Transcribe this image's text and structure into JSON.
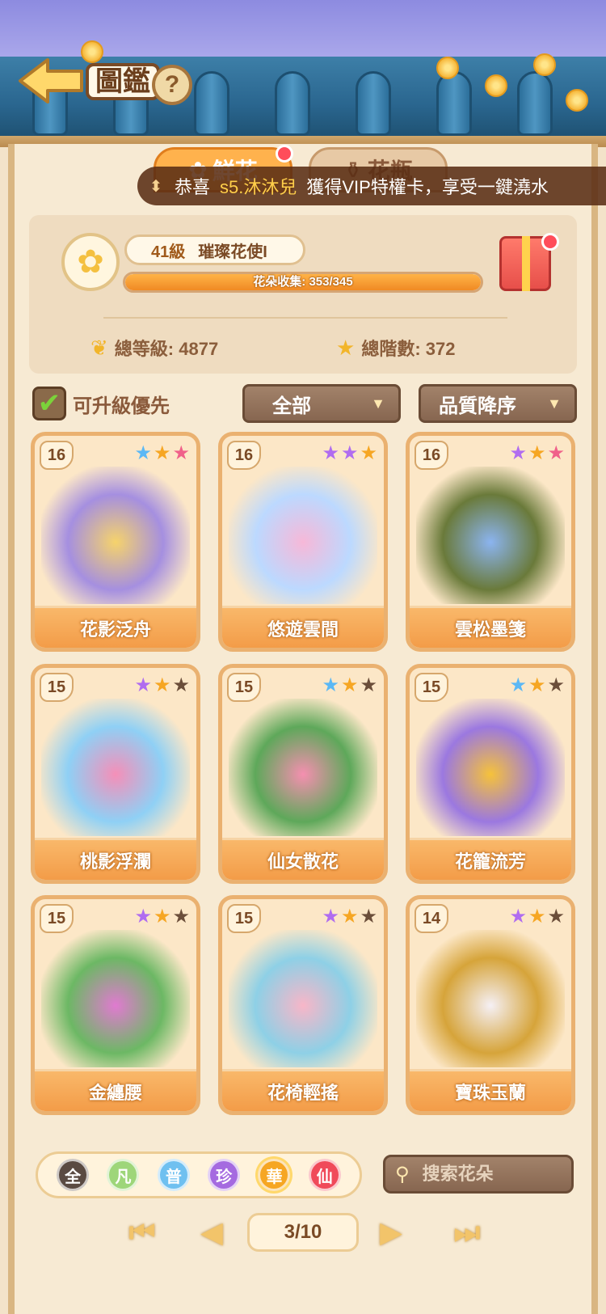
{
  "header": {
    "title": "圖鑑",
    "help_label": "?"
  },
  "tabs": [
    {
      "label": "鮮花",
      "icon": "flower-icon",
      "active": true,
      "has_notification": true
    },
    {
      "label": "花瓶",
      "icon": "vase-icon",
      "active": false,
      "has_notification": false
    }
  ],
  "announcement": {
    "prefix": "恭喜",
    "player": "s5.沐沐兒",
    "message": "獲得VIP特權卡，享受一鍵澆水"
  },
  "profile": {
    "level": "41級",
    "rank_title": "璀璨花使I",
    "collection_text": "花朵收集: 353/345",
    "collection_fraction": 1.0,
    "total_level_label": "總等級: 4877",
    "total_stars_label": "總階數: 372"
  },
  "filters": {
    "upgrade_first_label": "可升級優先",
    "upgrade_first_checked": true,
    "category": "全部",
    "sort": "品質降序"
  },
  "cards": [
    {
      "level": "16",
      "name": "花影泛舟",
      "stars": [
        "#5bb8f5",
        "#f6a623",
        "#f0608a"
      ],
      "art": [
        "#f6d36b",
        "#a58fe0"
      ]
    },
    {
      "level": "16",
      "name": "悠遊雲間",
      "stars": [
        "#b06cf0",
        "#b06cf0",
        "#f6a623"
      ],
      "art": [
        "#f7b8d8",
        "#bcd9ff"
      ]
    },
    {
      "level": "16",
      "name": "雲松墨箋",
      "stars": [
        "#b06cf0",
        "#f6a623",
        "#f0608a"
      ],
      "art": [
        "#8bb4f0",
        "#6a7a3a"
      ]
    },
    {
      "level": "15",
      "name": "桃影浮瀾",
      "stars": [
        "#b06cf0",
        "#f6a623",
        "#6b4e3a"
      ],
      "art": [
        "#f58fb8",
        "#8fd0f5"
      ]
    },
    {
      "level": "15",
      "name": "仙女散花",
      "stars": [
        "#5bb8f5",
        "#f6a623",
        "#6b4e3a"
      ],
      "art": [
        "#f58fb0",
        "#5ea85a"
      ]
    },
    {
      "level": "15",
      "name": "花籠流芳",
      "stars": [
        "#5bb8f5",
        "#f6a623",
        "#6b4e3a"
      ],
      "art": [
        "#f6c23a",
        "#9b78e0"
      ]
    },
    {
      "level": "15",
      "name": "金纏腰",
      "stars": [
        "#b06cf0",
        "#f6a623",
        "#6b4e3a"
      ],
      "art": [
        "#e07ad0",
        "#6cb864"
      ]
    },
    {
      "level": "15",
      "name": "花椅輕搖",
      "stars": [
        "#b06cf0",
        "#f6a623",
        "#6b4e3a"
      ],
      "art": [
        "#f8b6c8",
        "#8ed0e6"
      ]
    },
    {
      "level": "14",
      "name": "寶珠玉蘭",
      "stars": [
        "#b06cf0",
        "#f6a623",
        "#6b4e3a"
      ],
      "art": [
        "#f5f0f5",
        "#d6a43a"
      ]
    }
  ],
  "rarity_filters": [
    {
      "label": "全",
      "color": "#5a4a42"
    },
    {
      "label": "凡",
      "color": "#9ed67a"
    },
    {
      "label": "普",
      "color": "#6fc0f0"
    },
    {
      "label": "珍",
      "color": "#a56ae0"
    },
    {
      "label": "華",
      "color": "#f6a623"
    },
    {
      "label": "仙",
      "color": "#f04a5a"
    }
  ],
  "search": {
    "placeholder": "搜索花朵"
  },
  "pagination": {
    "page_text": "3/10"
  }
}
